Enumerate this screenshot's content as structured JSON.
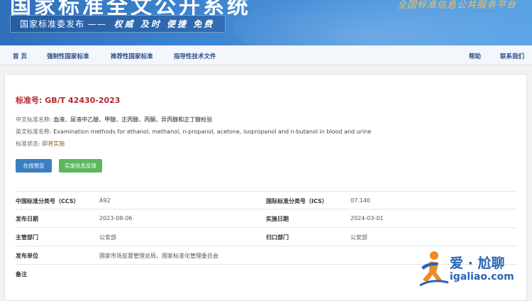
{
  "header": {
    "site_title": "国家标准全文公开系统",
    "slogan_prefix": "国家标准委发布 ——",
    "slogan_values": "权威 及时 便捷 免费",
    "motto": "全国标准信息公共服务平台"
  },
  "nav": {
    "items": [
      {
        "label": "首 页"
      },
      {
        "label": "强制性国家标准"
      },
      {
        "label": "推荐性国家标准"
      },
      {
        "label": "指导性技术文件"
      }
    ],
    "help": "帮助",
    "contact": "联系我们"
  },
  "standard": {
    "number_label": "标准号:",
    "number": "GB/T 42430-2023",
    "cn_name_label": "中文标准名称:",
    "cn_name": "血液、尿液中乙醇、甲醇、正丙醇、丙酮、异丙醇和正丁醇检验",
    "en_name_label": "英文标准名称:",
    "en_name": "Examination methods for ethanol, methanol, n-propanol, acetone, isopropanol and n-butanol in blood and urine",
    "status_label": "标准状态:",
    "status": "即将实施"
  },
  "buttons": {
    "preview": "在线预览",
    "feedback": "实施信息反馈"
  },
  "details": {
    "ccs_label": "中国标准分类号（CCS）",
    "ccs": "A92",
    "ics_label": "国际标准分类号（ICS）",
    "ics": "07.140",
    "publish_label": "发布日期",
    "publish_date": "2023-08-06",
    "implement_label": "实施日期",
    "implement_date": "2024-03-01",
    "dept_label": "主管部门",
    "dept": "公安部",
    "tech_dept_label": "归口部门",
    "tech_dept": "公安部",
    "issuer_label": "发布单位",
    "issuer": "国家市场监督管理总局、国家标准化管理委员会",
    "remarks_label": "备注"
  },
  "watermark": {
    "brand": "爱 · 尬聊",
    "url": "igaliao.com"
  },
  "colors": {
    "banner": "#3d83cf",
    "nav_text": "#2a4c86",
    "std_number": "#b8262c",
    "preview_button": "#3a7fc1",
    "feedback_button": "#5cb85c",
    "motto": "#f3c24a"
  },
  "icons": {
    "watermark_logo": "running-figure-icon"
  }
}
